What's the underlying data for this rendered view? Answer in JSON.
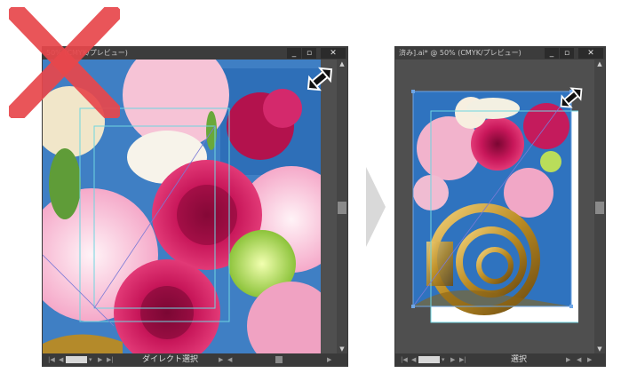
{
  "left_window": {
    "title": "50% (CMYK/プレビュー)",
    "buttons": [
      "_",
      "▫",
      "✕"
    ],
    "status_tool": "ダイレクト選択"
  },
  "right_window": {
    "title": "済み].ai* @ 50% (CMYK/プレビュー)",
    "buttons": [
      "_",
      "▫",
      "✕"
    ],
    "status_tool": "選択"
  },
  "icons": {
    "wrong_mark": "x-mark-icon",
    "next": "chevron-right-icon",
    "resize": "resize-diagonal-icon"
  },
  "colors": {
    "wrong_mark": "#e8474c",
    "guide": "#6fd6e0",
    "window_bg": "#4f4f4f",
    "titlebar": "#3c3c3c"
  }
}
